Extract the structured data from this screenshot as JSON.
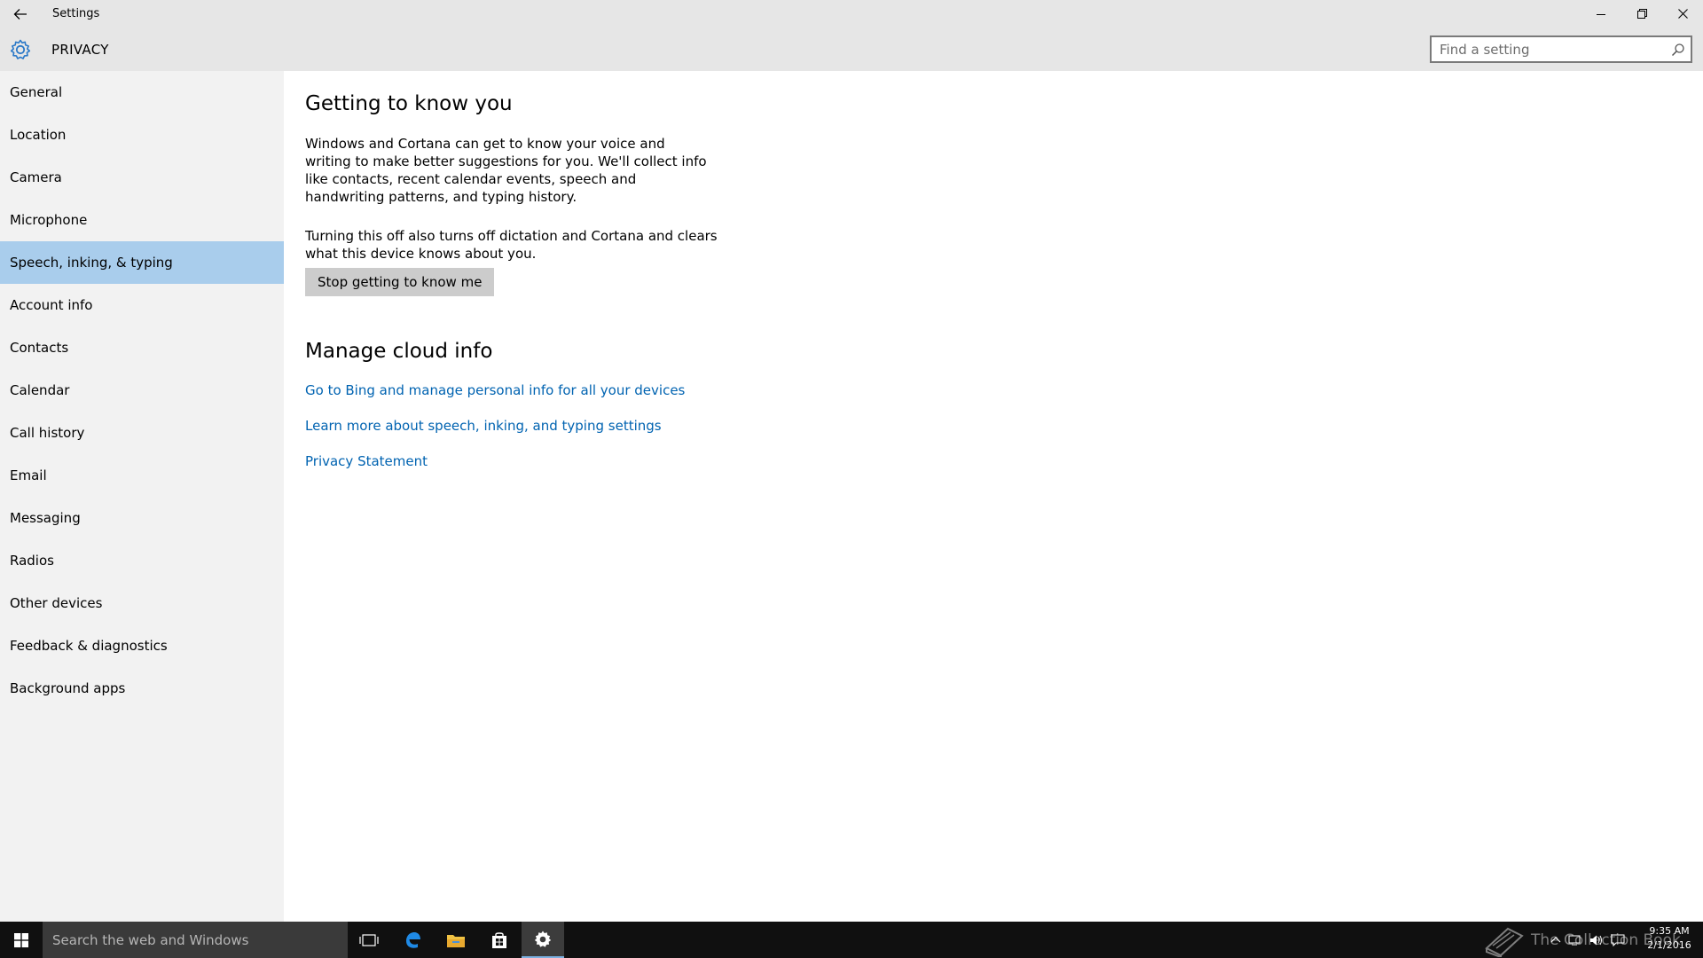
{
  "window": {
    "title": "Settings"
  },
  "header": {
    "section_title": "PRIVACY",
    "search_placeholder": "Find a setting"
  },
  "sidebar": {
    "items": [
      {
        "label": "General"
      },
      {
        "label": "Location"
      },
      {
        "label": "Camera"
      },
      {
        "label": "Microphone"
      },
      {
        "label": "Speech, inking, & typing",
        "selected": true
      },
      {
        "label": "Account info"
      },
      {
        "label": "Contacts"
      },
      {
        "label": "Calendar"
      },
      {
        "label": "Call history"
      },
      {
        "label": "Email"
      },
      {
        "label": "Messaging"
      },
      {
        "label": "Radios"
      },
      {
        "label": "Other devices"
      },
      {
        "label": "Feedback & diagnostics"
      },
      {
        "label": "Background apps"
      }
    ]
  },
  "main": {
    "section1_title": "Getting to know you",
    "section1_para1": "Windows and Cortana can get to know your voice and writing to make better suggestions for you. We'll collect info like contacts, recent calendar events, speech and handwriting patterns, and typing history.",
    "section1_para2": "Turning this off also turns off dictation and Cortana and clears what this device knows about you.",
    "stop_button_label": "Stop getting to know me",
    "section2_title": "Manage cloud info",
    "links": [
      {
        "label": "Go to Bing and manage personal info for all your devices"
      },
      {
        "label": "Learn more about speech, inking, and typing settings"
      },
      {
        "label": "Privacy Statement"
      }
    ]
  },
  "taskbar": {
    "search_placeholder": "Search the web and Windows",
    "watermark": "The Collection Book",
    "clock_time": "9:35 AM",
    "clock_date": "2/1/2016"
  },
  "colors": {
    "accent": "#0063b1",
    "selected_nav": "#a9cdec",
    "chrome": "#e6e6e6",
    "sidebar": "#f2f2f2",
    "taskbar": "#101010"
  },
  "icons": [
    "back-arrow-icon",
    "minimize-icon",
    "maximize-icon",
    "close-icon",
    "gear-icon",
    "search-icon",
    "windows-logo-icon",
    "task-view-icon",
    "edge-icon",
    "file-explorer-icon",
    "store-icon",
    "settings-gear-icon",
    "book-icon",
    "chevron-up-icon",
    "network-icon",
    "volume-icon",
    "notification-icon"
  ]
}
